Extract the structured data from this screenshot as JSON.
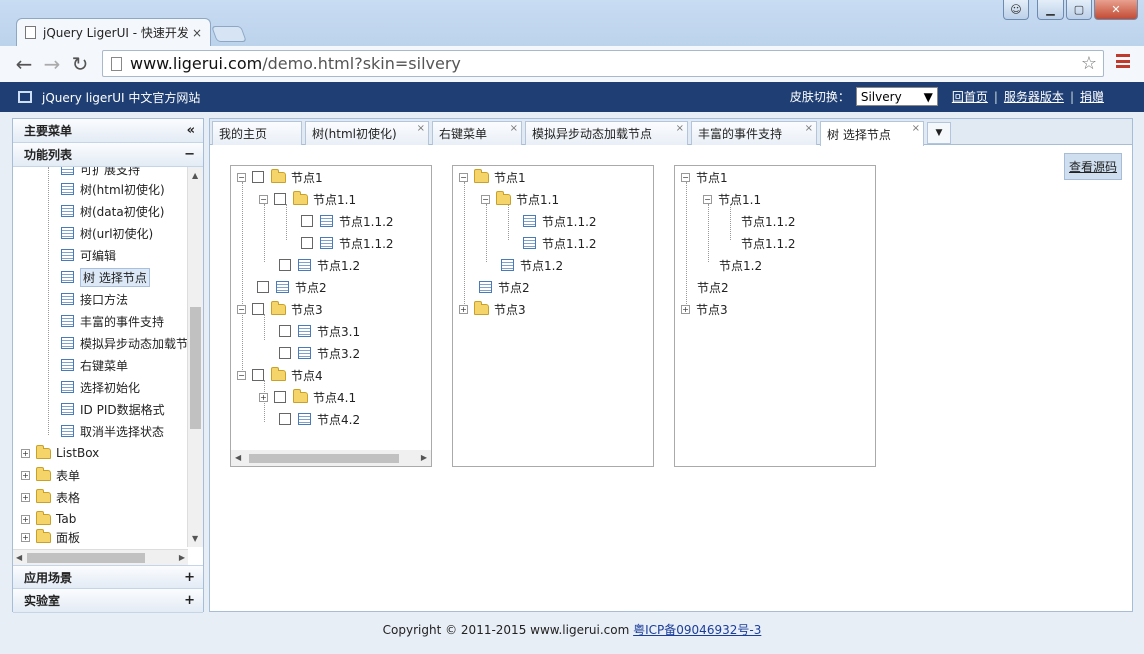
{
  "browser": {
    "tab_title": "jQuery LigerUI - 快速开发",
    "tab_close": "×",
    "url_host": "www.ligerui.com",
    "url_path": "/demo.html?skin=silvery",
    "window_buttons": {
      "minimize": "▁",
      "maximize": "▢",
      "close": "✕"
    }
  },
  "header": {
    "site_title": "jQuery ligerUI 中文官方网站",
    "skin_label": "皮肤切换：",
    "skin_value": "Silvery",
    "links": [
      "回首页",
      "服务器版本",
      "捐赠"
    ],
    "separator": "|"
  },
  "left_panel": {
    "main_menu": "主要菜单",
    "collapse_icon": "«",
    "function_list": "功能列表",
    "function_list_ctl": "−",
    "items": [
      "可扩展支持",
      "树(html初使化)",
      "树(data初使化)",
      "树(url初使化)",
      "可编辑",
      "树 选择节点",
      "接口方法",
      "丰富的事件支持",
      "模拟异步动态加载节点",
      "右键菜单",
      "选择初始化",
      "ID PID数据格式",
      "取消半选择状态"
    ],
    "selected_item": "树 选择节点",
    "folders": [
      "ListBox",
      "表单",
      "表格",
      "Tab",
      "面板"
    ],
    "folder_pm": "+",
    "app_scene": "应用场景",
    "lab": "实验室",
    "expand_ctl": "+"
  },
  "content": {
    "tabs": [
      {
        "label": "我的主页",
        "closable": false
      },
      {
        "label": "树(html初使化)",
        "closable": true
      },
      {
        "label": "右键菜单",
        "closable": true
      },
      {
        "label": "模拟异步动态加载节点",
        "closable": true
      },
      {
        "label": "丰富的事件支持",
        "closable": true
      },
      {
        "label": "树 选择节点",
        "closable": true,
        "active": true
      }
    ],
    "tab_close": "×",
    "tab_more": "▼",
    "view_source": "查看源码",
    "tree_nodes": {
      "n1": "节点1",
      "n11": "节点1.1",
      "n112a": "节点1.1.2",
      "n112b": "节点1.1.2",
      "n12": "节点1.2",
      "n2": "节点2",
      "n3": "节点3",
      "n31": "节点3.1",
      "n32": "节点3.2",
      "n4": "节点4",
      "n41": "节点4.1",
      "n42": "节点4.2"
    },
    "pm_open": "−",
    "pm_closed": "+"
  },
  "footer": {
    "copyright": "Copyright © 2011-2015 www.ligerui.com",
    "icp": "粤ICP备09046932号-3"
  }
}
